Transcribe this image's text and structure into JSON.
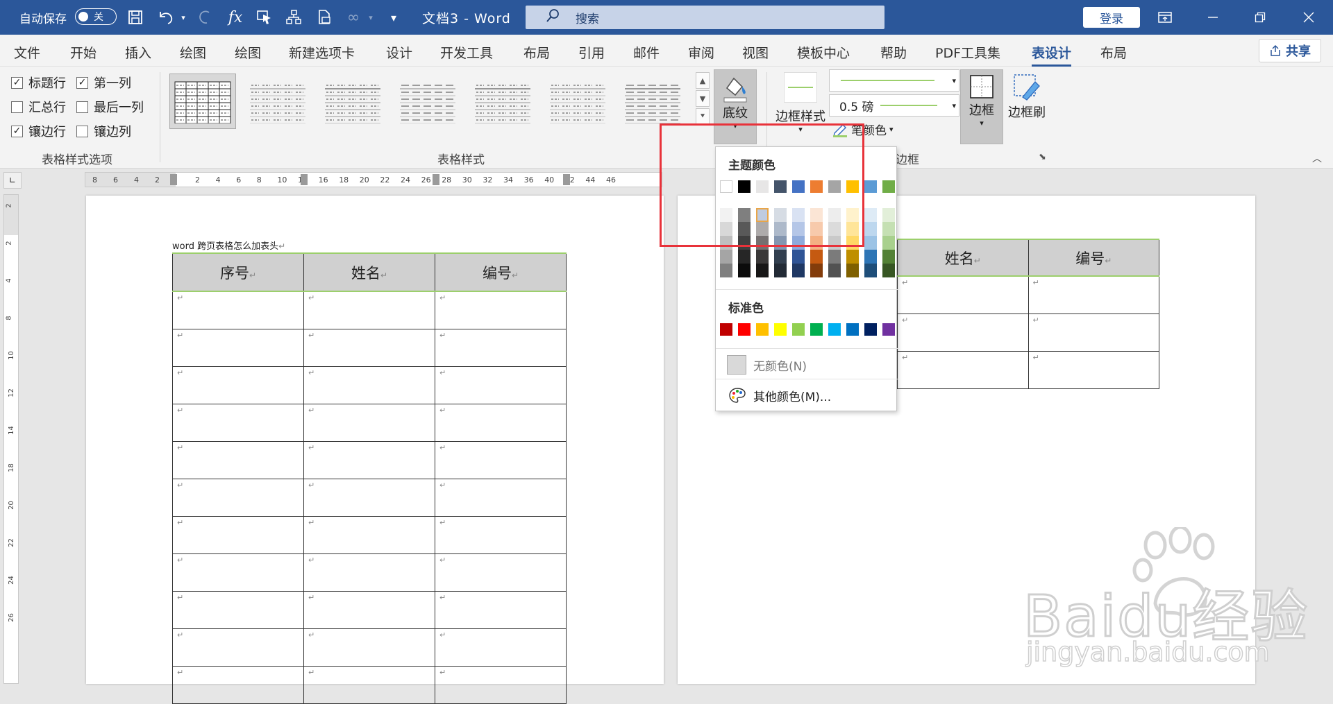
{
  "titlebar": {
    "autosave_label": "自动保存",
    "autosave_state": "关",
    "doc_title": "文档3  -  Word",
    "search_placeholder": "搜索",
    "login_label": "登录"
  },
  "tabs": [
    "文件",
    "开始",
    "插入",
    "绘图",
    "绘图",
    "新建选项卡",
    "设计",
    "开发工具",
    "布局",
    "引用",
    "邮件",
    "审阅",
    "视图",
    "模板中心",
    "帮助",
    "PDF工具集",
    "表设计",
    "布局"
  ],
  "active_tab": "表设计",
  "share_label": "共享",
  "ribbon": {
    "options": {
      "header_row": "标题行",
      "first_column": "第一列",
      "total_row": "汇总行",
      "last_column": "最后一列",
      "banded_rows": "镶边行",
      "banded_columns": "镶边列",
      "checked_header_row": true,
      "checked_first_column": true,
      "checked_total_row": false,
      "checked_last_column": false,
      "checked_banded_rows": true,
      "checked_banded_columns": false
    },
    "group_style_options": "表格样式选项",
    "group_table_styles": "表格样式",
    "shading_label": "底纹",
    "border_styles_label": "边框样式",
    "pen_weight": "0.5 磅",
    "pen_color_label": "笔颜色",
    "borders_label": "边框",
    "border_painter_label": "边框刷",
    "group_borders": "边框"
  },
  "ruler": {
    "h_left": [
      "8",
      "6",
      "4",
      "2"
    ],
    "h_right": [
      "2",
      "4",
      "6",
      "8",
      "10",
      "14",
      "16",
      "18",
      "20",
      "22",
      "24",
      "26",
      "28",
      "30",
      "32",
      "34",
      "36",
      "40",
      "42",
      "44",
      "46"
    ],
    "v": [
      "2",
      "2",
      "4",
      "8",
      "10",
      "12",
      "14",
      "18",
      "20",
      "22",
      "24",
      "26"
    ]
  },
  "document": {
    "caption": "word 跨页表格怎么加表头",
    "headers": [
      "序号",
      "姓名",
      "编号"
    ],
    "headers_page2": [
      "姓名",
      "编号"
    ]
  },
  "shading_menu": {
    "theme_colors_label": "主题颜色",
    "standard_colors_label": "标准色",
    "no_color_label": "无颜色(N)",
    "more_colors_label": "其他颜色(M)...",
    "theme_top": [
      "#FFFFFF",
      "#000000",
      "#E7E6E6",
      "#44546A",
      "#4472C4",
      "#ED7D31",
      "#A5A5A5",
      "#FFC000",
      "#5B9BD5",
      "#70AD47"
    ],
    "theme_shades": [
      [
        "#F2F2F2",
        "#7F7F7F",
        "#D0CECE",
        "#D6DCE4",
        "#D9E2F3",
        "#FBE5D5",
        "#EDEDED",
        "#FFF2CC",
        "#DEEBF6",
        "#E2EFD9"
      ],
      [
        "#D8D8D8",
        "#595959",
        "#AEABAB",
        "#ADB9CA",
        "#B4C6E7",
        "#F7CAAC",
        "#DBDBDB",
        "#FFE599",
        "#BDD7EE",
        "#C5E0B3"
      ],
      [
        "#BFBFBF",
        "#3F3F3F",
        "#757070",
        "#8496B0",
        "#8EAADB",
        "#F4B083",
        "#C9C9C9",
        "#FFD965",
        "#9CC3E5",
        "#A8D08D"
      ],
      [
        "#A5A5A5",
        "#262626",
        "#3A3838",
        "#323F4F",
        "#2F5496",
        "#C55A11",
        "#7B7B7B",
        "#BF8F00",
        "#2E75B5",
        "#538135"
      ],
      [
        "#7F7F7F",
        "#0C0C0C",
        "#171616",
        "#222A35",
        "#1F3864",
        "#833C0B",
        "#525252",
        "#7F6000",
        "#1E4E79",
        "#375623"
      ]
    ],
    "standard": [
      "#C00000",
      "#FF0000",
      "#FFC000",
      "#FFFF00",
      "#92D050",
      "#00B050",
      "#00B0F0",
      "#0070C0",
      "#002060",
      "#7030A0"
    ]
  },
  "watermark": {
    "brand": "Baidu经验",
    "url": "jingyan.baidu.com"
  }
}
